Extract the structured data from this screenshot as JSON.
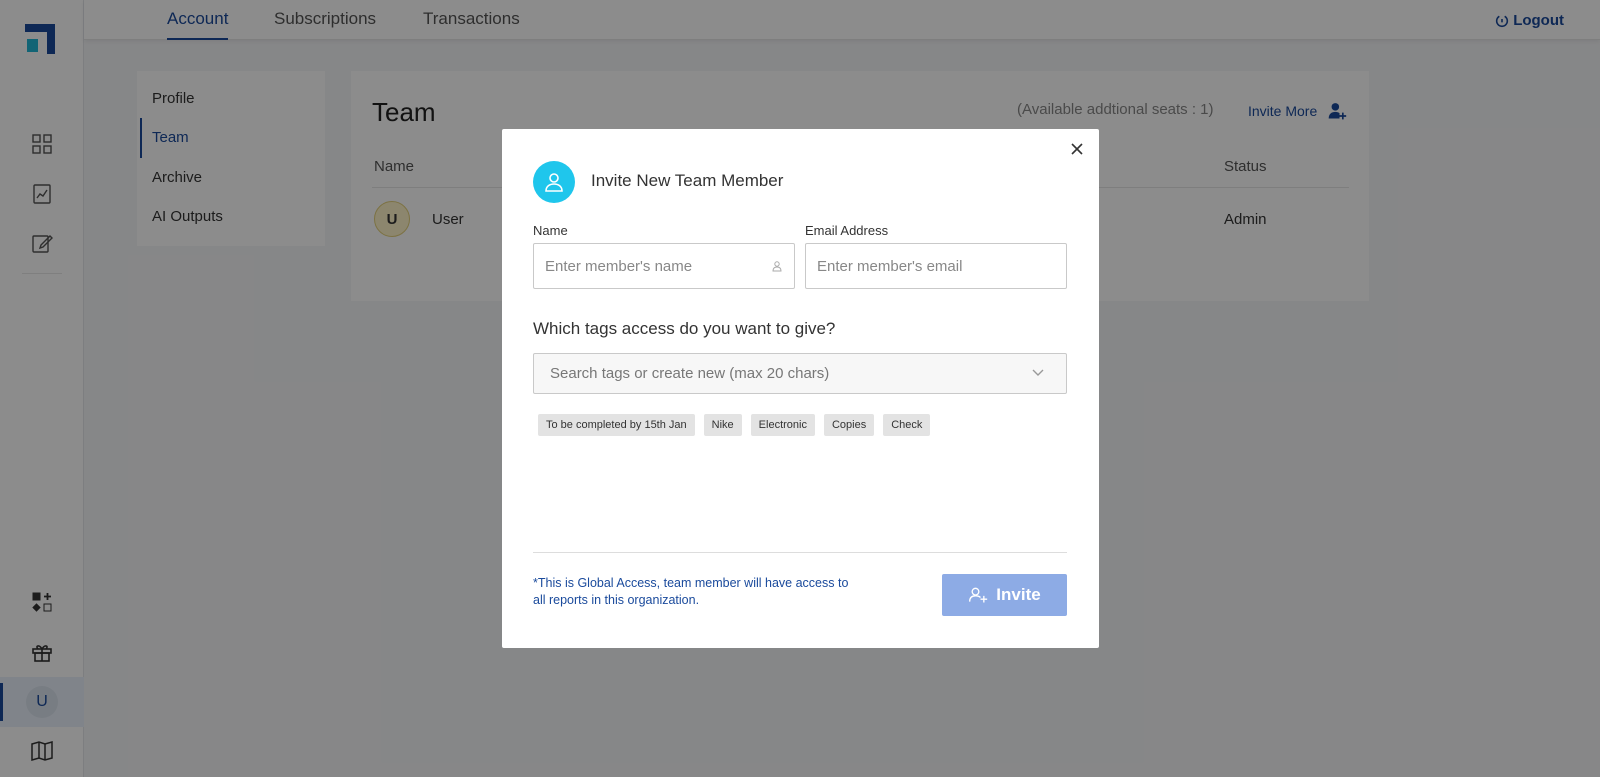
{
  "nav": {
    "tabs": [
      {
        "label": "Account"
      },
      {
        "label": "Subscriptions"
      },
      {
        "label": "Transactions"
      }
    ],
    "logout": "Logout"
  },
  "sidebar": {
    "avatar_initial": "U"
  },
  "submenu": {
    "items": [
      {
        "label": "Profile"
      },
      {
        "label": "Team"
      },
      {
        "label": "Archive"
      },
      {
        "label": "AI Outputs"
      }
    ]
  },
  "team": {
    "title": "Team",
    "seats": "(Available addtional seats : 1)",
    "invite_more": "Invite More",
    "columns": {
      "name": "Name",
      "status": "Status"
    },
    "rows": [
      {
        "initial": "U",
        "name": "User",
        "status": "Admin"
      }
    ]
  },
  "modal": {
    "title": "Invite New Team Member",
    "name_label": "Name",
    "name_placeholder": "Enter member's name",
    "email_label": "Email Address",
    "email_placeholder": "Enter member's email",
    "tags_question": "Which tags access do you want to give?",
    "tags_placeholder": "Search tags or create new (max 20 chars)",
    "tags": [
      "To be completed by 15th Jan",
      "Nike",
      "Electronic",
      "Copies",
      "Check"
    ],
    "note": "*This is Global Access, team member will have access to all reports in this organization.",
    "invite_button": "Invite"
  },
  "colors": {
    "primary": "#1a4a9c",
    "accent": "#1fc6ec",
    "invite_disabled": "#8dabe5"
  }
}
